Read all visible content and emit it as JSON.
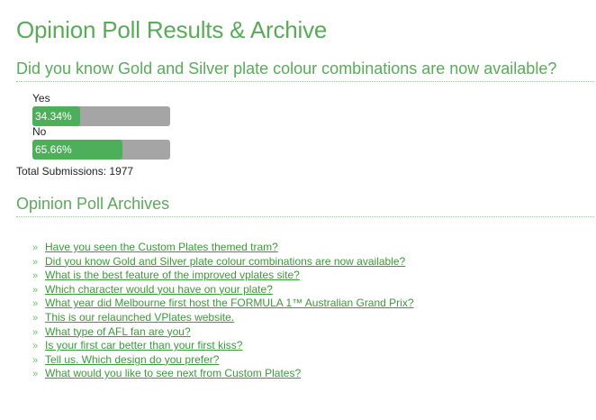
{
  "page": {
    "title": "Opinion Poll Results & Archive"
  },
  "poll": {
    "question": "Did you know Gold and Silver plate colour combinations are now available?",
    "answers": [
      {
        "label": "Yes",
        "percent_text": "34.34%",
        "percent": 34.34
      },
      {
        "label": "No",
        "percent_text": "65.66%",
        "percent": 65.66
      }
    ],
    "total_label": "Total Submissions:",
    "total_value": "1977",
    "colors": {
      "bar_fill": "#4daf5a",
      "bar_track": "#a5a5a5",
      "heading": "#5aaa5a"
    }
  },
  "archives": {
    "title": "Opinion Poll Archives",
    "bullet_glyph": "»",
    "items": [
      "Have you seen the Custom Plates themed tram?",
      "Did you know Gold and Silver plate colour combinations are now available?",
      "What is the best feature of the improved vplates site?",
      "Which character would you have on your plate?",
      "What year did Melbourne first host the FORMULA 1™ Australian Grand Prix?",
      "This is our relaunched VPlates website.",
      "What type of AFL fan are you?",
      "Is your first car better than your first kiss?",
      "Tell us. Which design do you prefer?",
      "What would you like to see next from Custom Plates?"
    ]
  }
}
